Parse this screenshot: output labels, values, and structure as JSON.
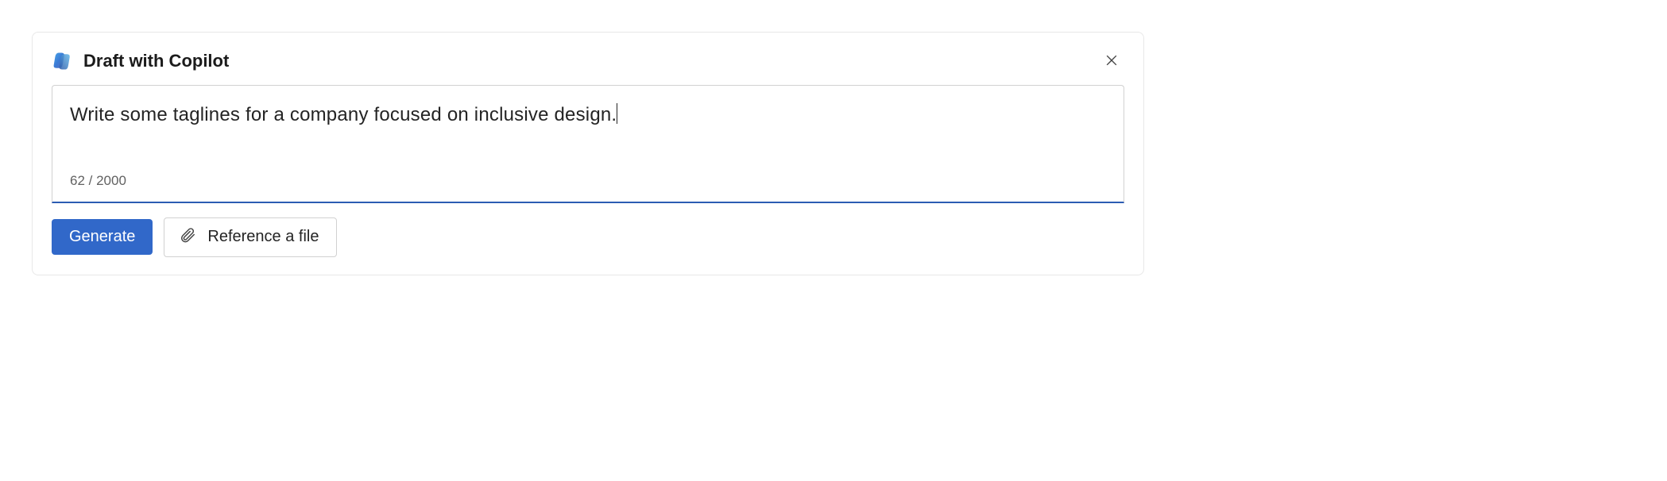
{
  "panel": {
    "title": "Draft with Copilot"
  },
  "input": {
    "prompt_text": "Write some taglines for a company focused on inclusive design.",
    "char_count": "62 / 2000"
  },
  "buttons": {
    "generate": "Generate",
    "reference_file": "Reference a file"
  }
}
